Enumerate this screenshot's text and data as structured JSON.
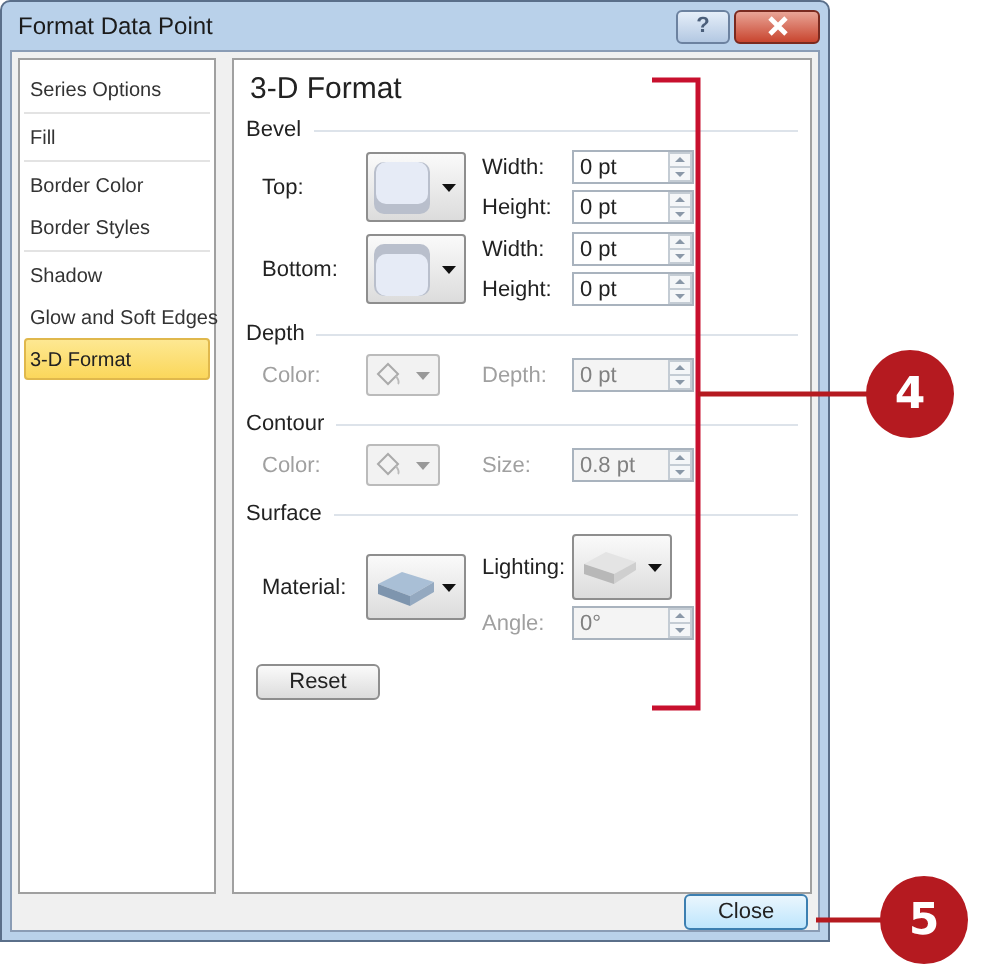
{
  "window": {
    "title": "Format Data Point",
    "help_button": "?"
  },
  "sidebar": {
    "groups": [
      {
        "items": [
          {
            "label": "Series Options",
            "selected": false
          }
        ]
      },
      {
        "items": [
          {
            "label": "Fill",
            "selected": false
          }
        ]
      },
      {
        "items": [
          {
            "label": "Border Color",
            "selected": false
          },
          {
            "label": "Border Styles",
            "selected": false
          }
        ]
      },
      {
        "items": [
          {
            "label": "Shadow",
            "selected": false
          },
          {
            "label": "Glow and Soft Edges",
            "selected": false
          },
          {
            "label": "3-D Format",
            "selected": true
          }
        ]
      }
    ]
  },
  "content": {
    "heading": "3-D Format",
    "sections": [
      {
        "title": "Bevel",
        "rows": [
          {
            "label": "Top:",
            "disabled": false,
            "picker": {
              "kind": "bevel-top",
              "disabled": false
            },
            "right": [
              {
                "kind": "spin",
                "label": "Width:",
                "value": "0 pt",
                "disabled": false
              },
              {
                "kind": "spin",
                "label": "Height:",
                "value": "0 pt",
                "disabled": false
              }
            ]
          },
          {
            "label": "Bottom:",
            "disabled": false,
            "picker": {
              "kind": "bevel-bottom",
              "disabled": false
            },
            "right": [
              {
                "kind": "spin",
                "label": "Width:",
                "value": "0 pt",
                "disabled": false
              },
              {
                "kind": "spin",
                "label": "Height:",
                "value": "0 pt",
                "disabled": false
              }
            ]
          }
        ]
      },
      {
        "title": "Depth",
        "rows": [
          {
            "label": "Color:",
            "disabled": true,
            "picker": {
              "kind": "color",
              "disabled": true
            },
            "right": [
              {
                "kind": "spin",
                "label": "Depth:",
                "value": "0 pt",
                "disabled": true
              }
            ]
          }
        ]
      },
      {
        "title": "Contour",
        "rows": [
          {
            "label": "Color:",
            "disabled": true,
            "picker": {
              "kind": "color",
              "disabled": true
            },
            "right": [
              {
                "kind": "spin",
                "label": "Size:",
                "value": "0.8 pt",
                "disabled": true
              }
            ]
          }
        ]
      },
      {
        "title": "Surface",
        "rows": [
          {
            "label": "Material:",
            "disabled": false,
            "picker": {
              "kind": "material",
              "disabled": false
            },
            "right": [
              {
                "kind": "picker",
                "label": "Lighting:",
                "picker": {
                  "kind": "lighting",
                  "disabled": false
                },
                "disabled": false
              },
              {
                "kind": "spin",
                "label": "Angle:",
                "value": "0°",
                "disabled": true
              }
            ]
          }
        ]
      }
    ],
    "reset_button": "Reset"
  },
  "close_button": "Close",
  "callouts": [
    {
      "number": "4"
    },
    {
      "number": "5"
    }
  ]
}
